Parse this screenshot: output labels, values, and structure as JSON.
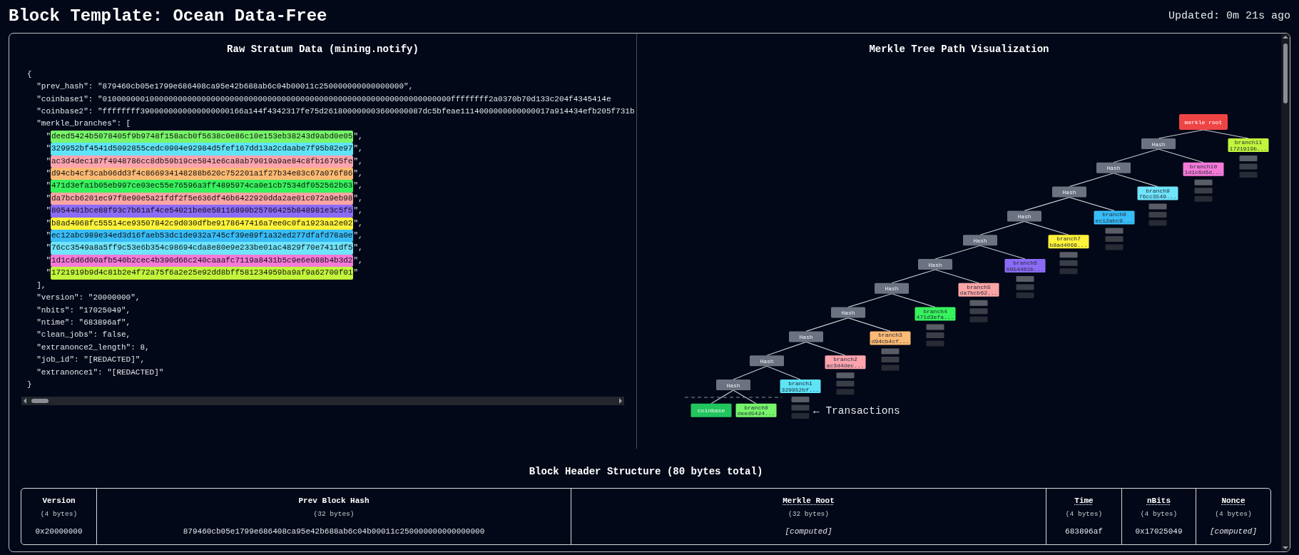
{
  "header": {
    "title": "Block Template: Ocean Data-Free",
    "updated": "Updated: 0m 21s ago"
  },
  "raw_panel": {
    "title": "Raw Stratum Data (mining.notify)",
    "lines": [
      {
        "kind": "brace",
        "text": "{"
      },
      {
        "kind": "field",
        "text": "\"prev_hash\": \"879460cb05e1799e686408ca95e42b688ab6c04b00011c250000000000000000\","
      },
      {
        "kind": "field",
        "text": "\"coinbase1\": \"01000000010000000000000000000000000000000000000000000000000000000000000000ffffffff2a0370b70d133c204f4345414e"
      },
      {
        "kind": "field",
        "text": "\"coinbase2\": \"ffffffff3900000000000000000166a144f4342317fe75d261800000003600000087dc5bfeae1114000000000000017a914434efb205f731b"
      },
      {
        "kind": "field",
        "text": "\"merkle_branches\": ["
      },
      {
        "kind": "item",
        "before": "\"",
        "hash": "deed5424b5078405f9b9748f158acb0f5638c0e86c10e153eb38243d9abd0e05",
        "after": "\",",
        "color": "#77f56a"
      },
      {
        "kind": "item",
        "before": "\"",
        "hash": "329952bf4541d5092855cedc0904e92984d5fef167dd13a2cdaabe7f95b82e97",
        "after": "\",",
        "color": "#5fe3f7"
      },
      {
        "kind": "item",
        "before": "\"",
        "hash": "ac3d4dec187f4948786cc8db59b19ce5841e6ca8ab79019a9ae84c8fb16795fe",
        "after": "\",",
        "color": "#fda4af"
      },
      {
        "kind": "item",
        "before": "\"",
        "hash": "d94cb4cf3cab06dd3f4c866934148288b620c752201a1f27b34e83c67a076f86",
        "after": "\",",
        "color": "#fdba74"
      },
      {
        "kind": "item",
        "before": "\"",
        "hash": "471d3efa1b05eb997ce03ec55e76596a3ff4895974ca0e1cb7534df052562b63",
        "after": "\",",
        "color": "#36f25c"
      },
      {
        "kind": "item",
        "before": "\"",
        "hash": "da7bcb6201ec97f8e90e5a21fdf2f5e636df46b6422920dda2ae01c072a9eb98",
        "after": "\",",
        "color": "#fca5a5"
      },
      {
        "kind": "item",
        "before": "\"",
        "hash": "8054401bce88f93c7b61af4ce54021be8e58116890b25706425b848981e3c5f5",
        "after": "\",",
        "color": "#8b6cf6"
      },
      {
        "kind": "item",
        "before": "\"",
        "hash": "b8ad4068fc55514ce93507842c9d030dfbe9178647416a7ee0c0fa1923aa2e02",
        "after": "\",",
        "color": "#fff23a"
      },
      {
        "kind": "item",
        "before": "\"",
        "hash": "ec12abc989e34ed3d16faeb53dc1de932a745cf39e89f1a32ed277dfafd78a0e",
        "after": "\",",
        "color": "#38bdf8"
      },
      {
        "kind": "item",
        "before": "\"",
        "hash": "76cc3549a8a5ff9c53e6b354c98694cda8e80e9e233be01ac4829f70e7411df5",
        "after": "\",",
        "color": "#70e4fa"
      },
      {
        "kind": "item",
        "before": "\"",
        "hash": "1d1c6d6d00afb540b2cec4b390d66c240caaafc7119a8431b5c9e6e088b4b3d2",
        "after": "\",",
        "color": "#f57ad8"
      },
      {
        "kind": "item",
        "before": "\"",
        "hash": "1721919b9d4c81b2e4f72a75f6a2e25e92dd8bff581234959ba9af9a62700f01",
        "after": "\"",
        "color": "#c2f53c"
      },
      {
        "kind": "field",
        "text": "],"
      },
      {
        "kind": "field",
        "text": "\"version\": \"20000000\","
      },
      {
        "kind": "field",
        "text": "\"nbits\": \"17025049\","
      },
      {
        "kind": "field",
        "text": "\"ntime\": \"683896af\","
      },
      {
        "kind": "field",
        "text": "\"clean_jobs\": false,"
      },
      {
        "kind": "field",
        "text": "\"extranonce2_length\": 8,"
      },
      {
        "kind": "field",
        "text": "\"job_id\": \"[REDACTED]\","
      },
      {
        "kind": "field",
        "text": "\"extranonce1\": \"[REDACTED]\""
      },
      {
        "kind": "brace",
        "text": "}"
      }
    ]
  },
  "merkle_panel": {
    "title": "Merkle Tree Path Visualization",
    "root": "merkle root",
    "hash_label": [
      "Hash",
      "Hash",
      "Hash",
      "Hash",
      "Hash",
      "Hash",
      "Hash",
      "Hash",
      "Hash",
      "Hash",
      "Hash"
    ],
    "coinbase": "coinbase",
    "transactions_label": "← Transactions",
    "branches": [
      {
        "label": "branch0",
        "short": "deed5424...",
        "color": "#77f56a"
      },
      {
        "label": "branch1",
        "short": "329952bf...",
        "color": "#5fe3f7"
      },
      {
        "label": "branch2",
        "short": "ac3d4dec...",
        "color": "#fda4af"
      },
      {
        "label": "branch3",
        "short": "d94cb4cf...",
        "color": "#fdba74"
      },
      {
        "label": "branch4",
        "short": "471d3efa...",
        "color": "#36f25c"
      },
      {
        "label": "branch5",
        "short": "da7bcb62...",
        "color": "#fca5a5"
      },
      {
        "label": "branch6",
        "short": "8054401b...",
        "color": "#8b6cf6"
      },
      {
        "label": "branch7",
        "short": "b8ad4068...",
        "color": "#fff23a"
      },
      {
        "label": "branch8",
        "short": "ec12abc9...",
        "color": "#38bdf8"
      },
      {
        "label": "branch9",
        "short": "76cc3549...",
        "color": "#70e4fa"
      },
      {
        "label": "branch10",
        "short": "1d1c6d6d...",
        "color": "#f57ad8"
      },
      {
        "label": "branch11",
        "short": "1721919b...",
        "color": "#c2f53c"
      }
    ]
  },
  "header_structure": {
    "title": "Block Header Structure (80 bytes total)",
    "fields": [
      {
        "name": "Version",
        "size": "(4 bytes)",
        "value": "0x20000000",
        "has_tooltip": false,
        "kind": "literal"
      },
      {
        "name": "Prev Block Hash",
        "size": "(32 bytes)",
        "value": "879460cb05e1799e686408ca95e42b688ab6c04b00011c250000000000000000",
        "has_tooltip": false,
        "kind": "literal"
      },
      {
        "name": "Merkle Root",
        "size": "(32 bytes)",
        "value": "[computed]",
        "has_tooltip": true,
        "kind": "computed"
      },
      {
        "name": "Time",
        "size": "(4 bytes)",
        "value": "683896af",
        "has_tooltip": true,
        "kind": "literal"
      },
      {
        "name": "nBits",
        "size": "(4 bytes)",
        "value": "0x17025049",
        "has_tooltip": true,
        "kind": "literal"
      },
      {
        "name": "Nonce",
        "size": "(4 bytes)",
        "value": "[computed]",
        "has_tooltip": true,
        "kind": "computed"
      }
    ]
  }
}
